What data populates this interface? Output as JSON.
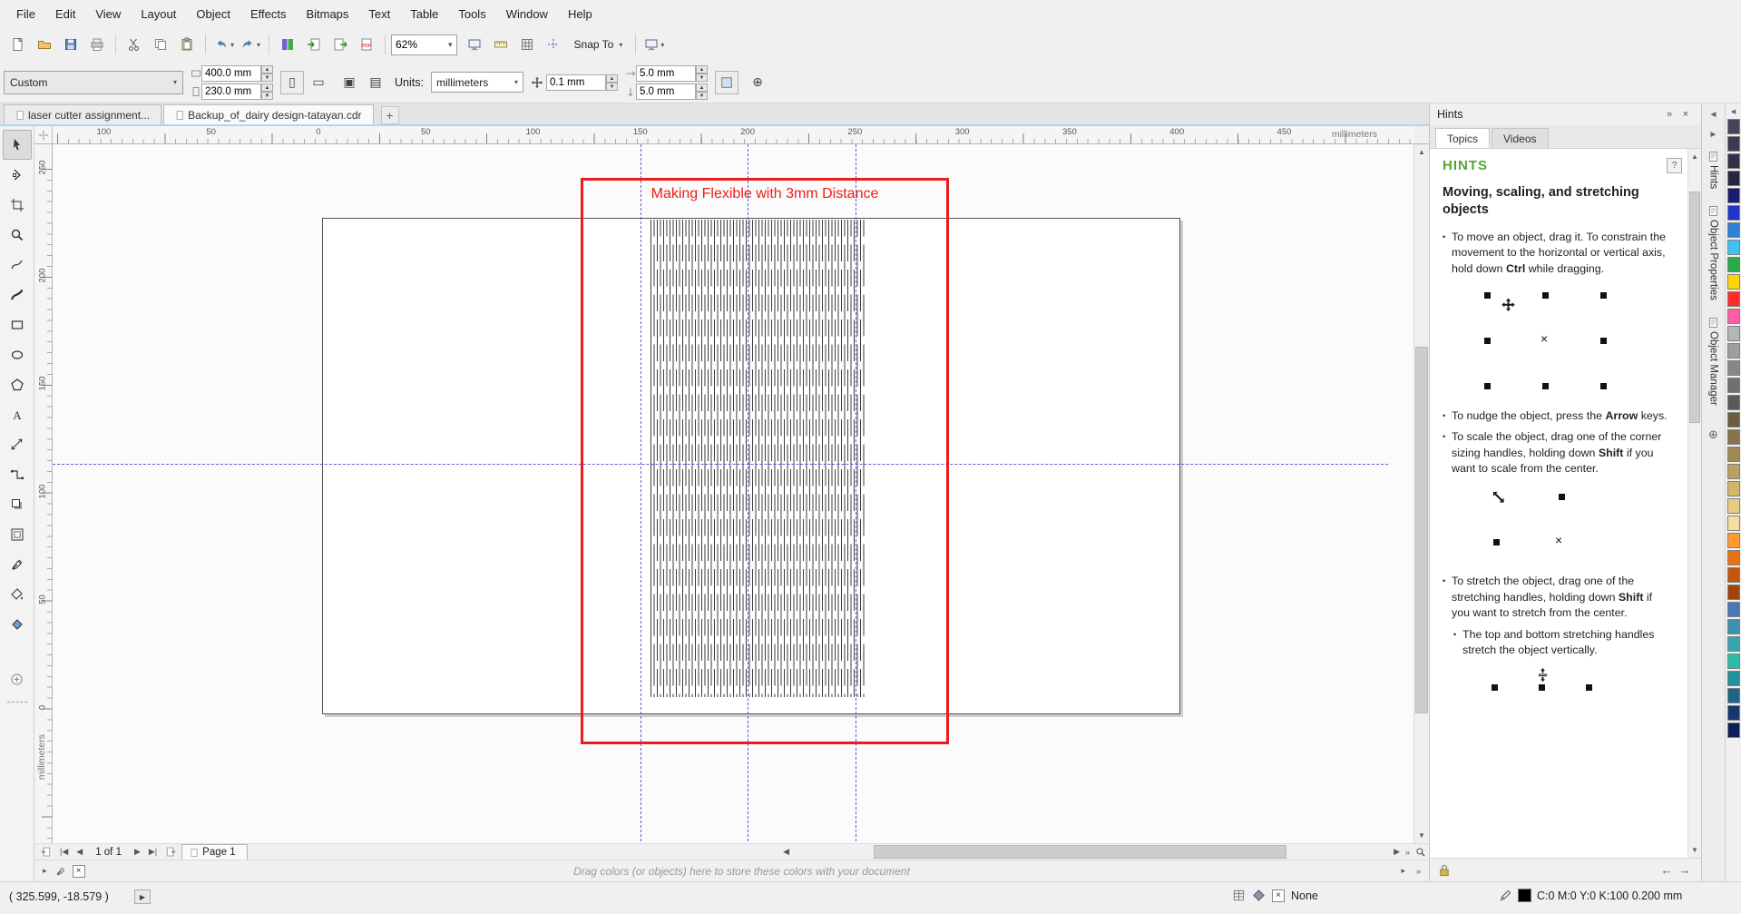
{
  "menubar": {
    "items": [
      "File",
      "Edit",
      "View",
      "Layout",
      "Object",
      "Effects",
      "Bitmaps",
      "Text",
      "Table",
      "Tools",
      "Window",
      "Help"
    ]
  },
  "toolbar": {
    "zoom_value": "62%",
    "snap_label": "Snap To",
    "group1": [
      {
        "name": "new-document-button",
        "icon": "new"
      },
      {
        "name": "open-button",
        "icon": "open"
      },
      {
        "name": "save-button",
        "icon": "save"
      },
      {
        "name": "print-button",
        "icon": "print"
      },
      {
        "sep": true
      },
      {
        "name": "cut-button",
        "icon": "cut"
      },
      {
        "name": "copy-button",
        "icon": "copy"
      },
      {
        "name": "paste-button",
        "icon": "paste"
      },
      {
        "sep": true
      },
      {
        "name": "undo-button",
        "icon": "undo",
        "dropdown": true
      },
      {
        "name": "redo-button",
        "icon": "redo",
        "dropdown": true
      },
      {
        "sep": true
      },
      {
        "name": "welcome-screen-button",
        "icon": "welcome"
      },
      {
        "name": "import-button",
        "icon": "import"
      },
      {
        "name": "export-button",
        "icon": "export"
      },
      {
        "name": "publish-pdf-button",
        "icon": "pdf"
      },
      {
        "sep": true
      }
    ],
    "group2": [
      {
        "name": "full-screen-preview-button",
        "icon": "monitor"
      },
      {
        "name": "show-rulers-button",
        "icon": "ruler"
      },
      {
        "name": "show-grid-button",
        "icon": "grid"
      },
      {
        "name": "show-guidelines-button",
        "icon": "guidelines"
      }
    ],
    "group3": [
      {
        "sep": true
      },
      {
        "name": "application-launcher-button",
        "icon": "monitor",
        "dropdown": true
      }
    ]
  },
  "property_bar": {
    "preset": "Custom",
    "width": "400.0 mm",
    "height": "230.0 mm",
    "units_label": "Units:",
    "units": "millimeters",
    "nudge": "0.1 mm",
    "dup_x": "5.0 mm",
    "dup_y": "5.0 mm"
  },
  "document_tabs": {
    "tabs": [
      {
        "label": "laser cutter assignment...",
        "active": false
      },
      {
        "label": "Backup_of_dairy design-tatayan.cdr",
        "active": true
      }
    ],
    "add_label": "+"
  },
  "rulers": {
    "unit": "millimeters",
    "horizontal_labels": [
      "100",
      "50",
      "0",
      "50",
      "100",
      "150",
      "200",
      "250",
      "300",
      "350",
      "400",
      "450"
    ],
    "vertical_labels": [
      "250",
      "200",
      "150",
      "100",
      "50",
      "0"
    ]
  },
  "toolbox": {
    "tools": [
      {
        "name": "pick-tool",
        "icon": "pick",
        "selected": true
      },
      {
        "name": "shape-tool",
        "icon": "shape"
      },
      {
        "name": "crop-tool",
        "icon": "crop"
      },
      {
        "name": "zoom-tool",
        "icon": "zoom"
      },
      {
        "name": "freehand-tool",
        "icon": "freehand"
      },
      {
        "name": "artistic-media-tool",
        "icon": "artistic"
      },
      {
        "name": "rectangle-tool",
        "icon": "rect"
      },
      {
        "name": "ellipse-tool",
        "icon": "ellipse"
      },
      {
        "name": "polygon-tool",
        "icon": "polygon"
      },
      {
        "name": "text-tool",
        "icon": "text"
      },
      {
        "name": "parallel-dimension-tool",
        "icon": "dimension"
      },
      {
        "name": "connector-tool",
        "icon": "connector"
      },
      {
        "name": "drop-shadow-tool",
        "icon": "shadow"
      },
      {
        "name": "contour-tool",
        "icon": "contour"
      },
      {
        "name": "color-eyedropper-tool",
        "icon": "eyedropper"
      },
      {
        "name": "interactive-fill-tool",
        "icon": "fill"
      },
      {
        "name": "smart-fill-tool",
        "icon": "smartfill"
      }
    ]
  },
  "canvas": {
    "annotation": "Making Flexible with 3mm Distance"
  },
  "page_nav": {
    "page_indicator": "1 of 1",
    "page_tab": "Page 1"
  },
  "doc_palette": {
    "hint": "Drag colors (or objects) here to store these colors with your document"
  },
  "hints_panel": {
    "title": "Hints",
    "tabs": [
      "Topics",
      "Videos"
    ],
    "heading": "HINTS",
    "section_title": "Moving, scaling, and stretching objects",
    "bullets": [
      {
        "segments": [
          {
            "t": "To move an object, drag it. To constrain the movement to the horizontal or vertical axis, hold down "
          },
          {
            "t": "Ctrl",
            "b": true
          },
          {
            "t": " while dragging."
          }
        ],
        "diagram": "move"
      },
      {
        "segments": [
          {
            "t": "To nudge the object, press the "
          },
          {
            "t": "Arrow",
            "b": true
          },
          {
            "t": " keys."
          }
        ]
      },
      {
        "segments": [
          {
            "t": "To scale the object, drag one of the corner sizing handles, holding down "
          },
          {
            "t": "Shift",
            "b": true
          },
          {
            "t": " if you want to scale from the center."
          }
        ],
        "diagram": "scale"
      },
      {
        "segments": [
          {
            "t": "To stretch the object, drag one of the stretching handles, holding down "
          },
          {
            "t": "Shift",
            "b": true
          },
          {
            "t": " if you want to stretch from the center."
          }
        ]
      },
      {
        "segments": [
          {
            "t": "The top and bottom stretching handles stretch the object vertically."
          }
        ],
        "sub": true,
        "diagram": "stretch"
      }
    ]
  },
  "side_tabs": {
    "items": [
      "Hints",
      "Object Properties",
      "Object Manager"
    ]
  },
  "color_palette": {
    "colors": [
      "#44445a",
      "#3a3a50",
      "#303046",
      "#26263c",
      "#1b1b6f",
      "#2233cc",
      "#2e7fd6",
      "#3fc1f0",
      "#2aa84a",
      "#ffd500",
      "#ff2b2b",
      "#ff5fa2",
      "#b5b5b5",
      "#9e9e9e",
      "#878787",
      "#707070",
      "#595959",
      "#6b5d3e",
      "#857349",
      "#9f8954",
      "#b99f60",
      "#d3b56b",
      "#e8cb82",
      "#f5dfa0",
      "#ff9a2e",
      "#e87113",
      "#c4560a",
      "#a34508",
      "#4a78b5",
      "#3f8fb0",
      "#35a6ab",
      "#2abda6",
      "#23919e",
      "#1c6586",
      "#15396e",
      "#0e1d56"
    ]
  },
  "status_bar": {
    "coordinates": "( 325.599, -18.579 )",
    "fill_label": "None",
    "outline_values": "C:0 M:0 Y:0 K:100  0.200 mm"
  }
}
